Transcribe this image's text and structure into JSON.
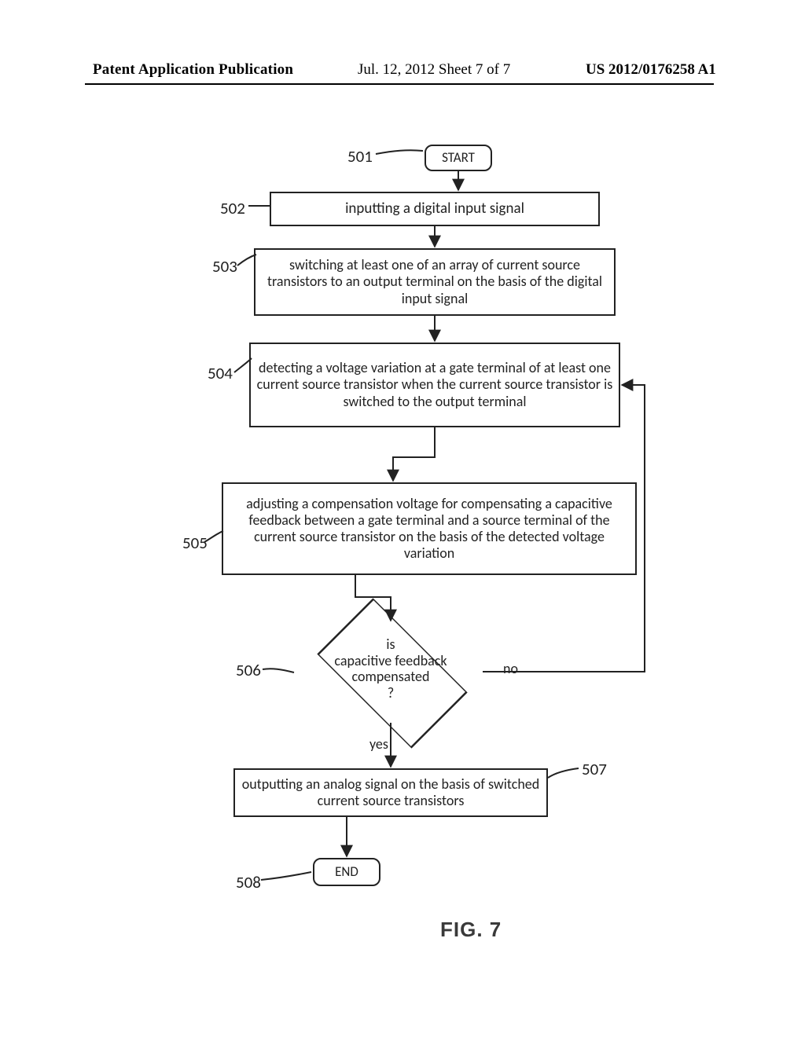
{
  "header": {
    "left": "Patent Application Publication",
    "mid": "Jul. 12, 2012   Sheet 7 of 7",
    "right": "US 2012/0176258 A1"
  },
  "figure_caption": "FIG. 7",
  "labels": {
    "l501": "501",
    "l502": "502",
    "l503": "503",
    "l504": "504",
    "l505": "505",
    "l506": "506",
    "l507": "507",
    "l508": "508"
  },
  "nodes": {
    "start": "START",
    "n502": "inputting a digital input signal",
    "n503": "switching at least one of an array of current source transistors to an output terminal on the basis of the digital input signal",
    "n504": "detecting a voltage variation at a gate terminal of at least one current source transistor when the current source transistor is switched to the output terminal",
    "n505": "adjusting a compensation voltage for compensating a capacitive feedback between a gate terminal and a source terminal of the current source transistor on the basis of the detected voltage variation",
    "decision_l1": "is",
    "decision_l2": "capacitive feedback",
    "decision_l3": "compensated",
    "decision_l4": "?",
    "yes": "yes",
    "no": "no",
    "n507": "outputting an analog signal on the basis of switched current source transistors",
    "end": "END"
  },
  "chart_data": {
    "type": "flowchart",
    "nodes": [
      {
        "id": "501",
        "kind": "terminator",
        "text": "START"
      },
      {
        "id": "502",
        "kind": "process",
        "text": "inputting a digital input signal"
      },
      {
        "id": "503",
        "kind": "process",
        "text": "switching at least one of an array of current source transistors to an output terminal on the basis of the digital input signal"
      },
      {
        "id": "504",
        "kind": "process",
        "text": "detecting a voltage variation at a gate terminal of at least one current source transistor when the current source transistor is switched to the output terminal"
      },
      {
        "id": "505",
        "kind": "process",
        "text": "adjusting a compensation voltage for compensating a capacitive feedback between a gate terminal and a source terminal of the current source transistor on the basis of the detected voltage variation"
      },
      {
        "id": "506",
        "kind": "decision",
        "text": "is capacitive feedback compensated ?"
      },
      {
        "id": "507",
        "kind": "process",
        "text": "outputting an analog signal on the basis of switched current source transistors"
      },
      {
        "id": "508",
        "kind": "terminator",
        "text": "END"
      }
    ],
    "edges": [
      {
        "from": "501",
        "to": "502"
      },
      {
        "from": "502",
        "to": "503"
      },
      {
        "from": "503",
        "to": "504"
      },
      {
        "from": "504",
        "to": "505"
      },
      {
        "from": "505",
        "to": "506"
      },
      {
        "from": "506",
        "to": "507",
        "label": "yes"
      },
      {
        "from": "506",
        "to": "504",
        "label": "no"
      },
      {
        "from": "507",
        "to": "508"
      }
    ]
  }
}
